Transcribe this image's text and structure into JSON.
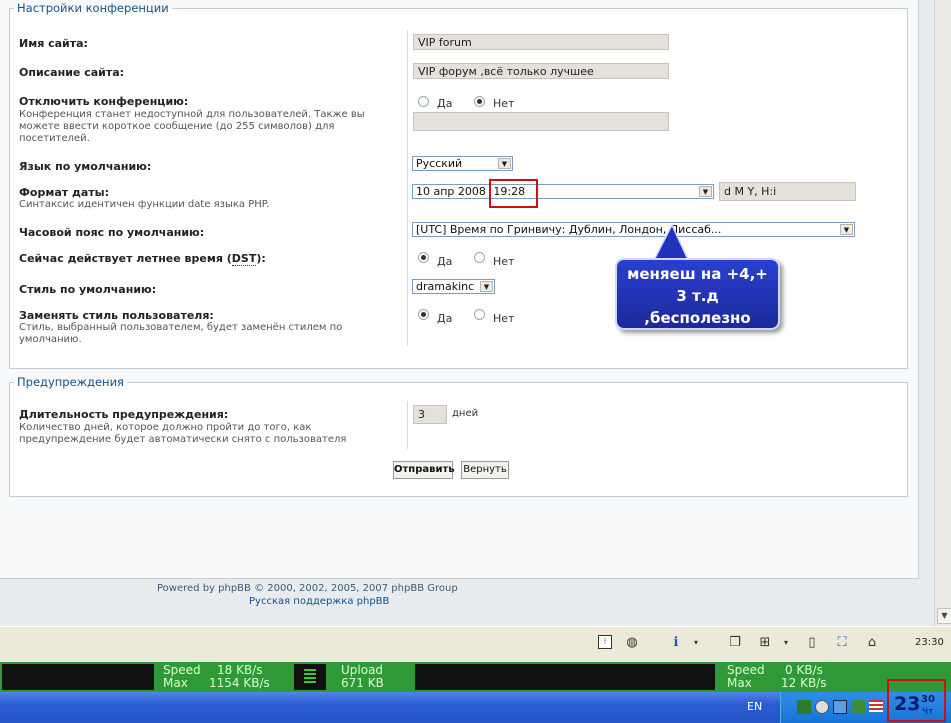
{
  "settings": {
    "legend": "Настройки конференции",
    "site_name": {
      "label": "Имя сайта:",
      "value": "VIP forum"
    },
    "site_desc": {
      "label": "Описание сайта:",
      "value": "VIP форум ,всё только лучшее"
    },
    "disable_board": {
      "label": "Отключить конференцию:",
      "desc": "Конференция станет недоступной для пользователей. Также вы можете ввести короткое сообщение (до 255 символов) для посетителей.",
      "yes": "Да",
      "no": "Нет"
    },
    "default_lang": {
      "label": "Язык по умолчанию:",
      "value": "Русский"
    },
    "date_format": {
      "label": "Формат даты:",
      "desc": "Синтаксис идентичен функции date языка PHP.",
      "date_part": "10 апр 2008",
      "time_part": "19:28",
      "custom": "d M Y, H:i"
    },
    "timezone": {
      "label": "Часовой пояс по умолчанию:",
      "value": "[UTC] Время по Гринвичу: Дублин, Лондон, Лиссаб..."
    },
    "dst": {
      "label_pre": "Сейчас действует летнее время (",
      "abbr": "DST",
      "label_post": "):",
      "yes": "Да",
      "no": "Нет"
    },
    "default_style": {
      "label": "Стиль по умолчанию:",
      "value": "dramakinc"
    },
    "override_style": {
      "label": "Заменять стиль пользователя:",
      "desc": "Стиль, выбранный пользователем, будет заменён стилем по умолчанию.",
      "yes": "Да",
      "no": "Нет"
    }
  },
  "warnings": {
    "legend": "Предупреждения",
    "duration": {
      "label": "Длительность предупреждения:",
      "desc": "Количество дней, которое должно пройти до того, как предупреждение будет автоматически снято с пользователя",
      "value": "3",
      "unit": "дней"
    }
  },
  "buttons": {
    "submit": "Отправить",
    "reset": "Вернуть"
  },
  "footer": {
    "powered": "Powered by phpBB © 2000, 2002, 2005, 2007 phpBB Group",
    "support": "Русская поддержка phpBB"
  },
  "callout": {
    "line1": "меняеш на +4,+",
    "line2": "3  т.д",
    "line3": ",бесполезно"
  },
  "toolbar": {
    "time": "23:30"
  },
  "speed": {
    "left": {
      "speed_label": "Speed",
      "speed_value": "18 KB/s",
      "max_label": "Max",
      "max_value": "1154 KB/s"
    },
    "upload": {
      "label": "Upload",
      "value": "671 KB"
    },
    "right": {
      "speed_label": "Speed",
      "speed_value": "0 KB/s",
      "max_label": "Max",
      "max_value": "12 KB/s"
    }
  },
  "taskbar": {
    "lang": "EN",
    "clock_hour": "23",
    "clock_min": "30",
    "clock_day": "Чт"
  },
  "colors": {
    "accent": "#105289",
    "highlight": "#d01010",
    "callout": "#2233bb",
    "meter_green": "#2f9a35"
  }
}
